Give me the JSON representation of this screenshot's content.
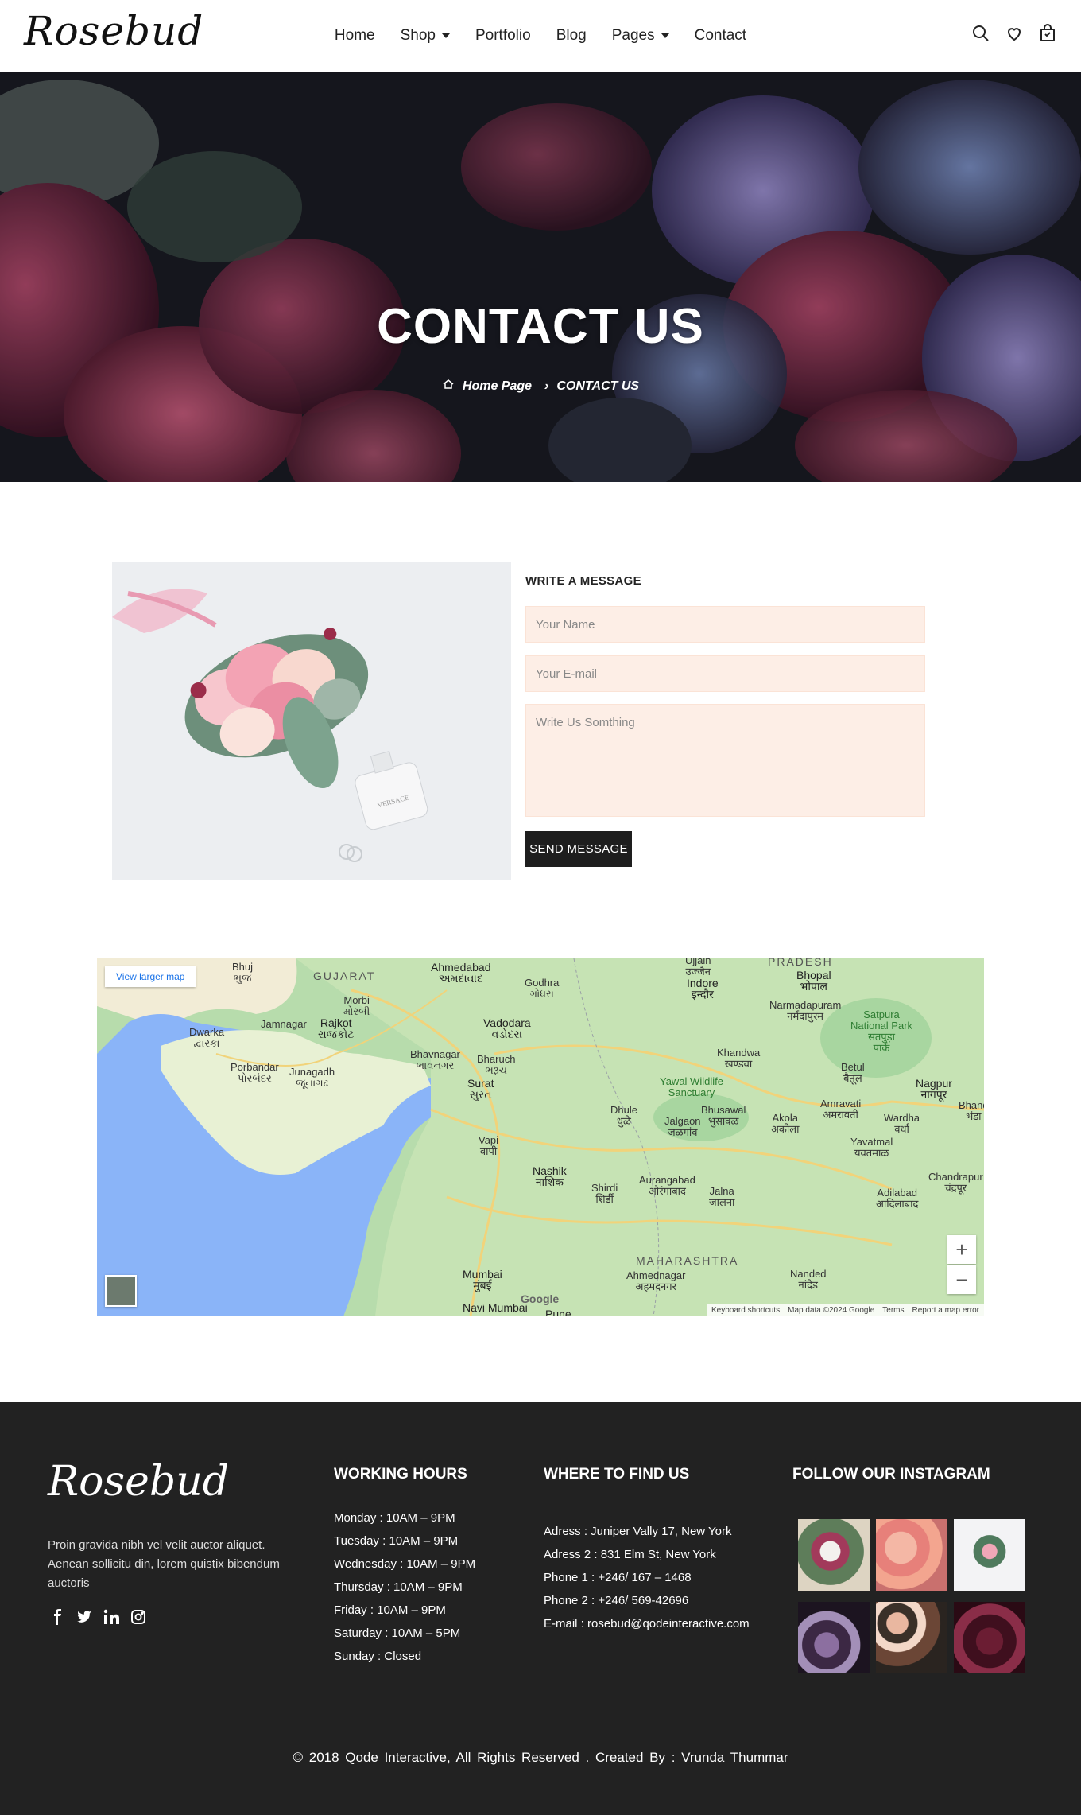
{
  "header": {
    "logo": "Rosebud",
    "nav": [
      {
        "label": "Home",
        "dropdown": false
      },
      {
        "label": "Shop",
        "dropdown": true
      },
      {
        "label": "Portfolio",
        "dropdown": false
      },
      {
        "label": "Blog",
        "dropdown": false
      },
      {
        "label": "Pages",
        "dropdown": true
      },
      {
        "label": "Contact",
        "dropdown": false
      }
    ],
    "icons": [
      "search-icon",
      "heart-icon",
      "cart-icon"
    ]
  },
  "hero": {
    "title": "CONTACT US",
    "breadcrumb": {
      "home": "Home Page",
      "current": "CONTACT US"
    }
  },
  "contact": {
    "form_title": "WRITE A MESSAGE",
    "name_placeholder": "Your Name",
    "email_placeholder": "Your E-mail",
    "message_placeholder": "Write Us Somthing",
    "send_label": "SEND MESSAGE"
  },
  "map": {
    "view_larger": "View larger map",
    "zoom_in": "+",
    "zoom_out": "−",
    "footer_items": [
      "Keyboard shortcuts",
      "Map data ©2024 Google",
      "Terms",
      "Report a map error"
    ],
    "labels": {
      "bhuj": "Bhuj\nભુજ",
      "gujarat": "GUJARAT",
      "ahmedabad": "Ahmedabad\nઅમદાવાદ",
      "ujjain": "Ujjain\nउज्जैन",
      "pradesh": "PRADESH",
      "bhopal": "Bhopal\nभोपाल",
      "godhra": "Godhra\nગોધરા",
      "indore": "Indore\nइन्दौर",
      "narmadapuram": "Narmadapuram\nनर्मदापुरम",
      "morbi": "Morbi\nમોરબી",
      "jamnagar": "Jamnagar",
      "rajkot": "Rajkot\nરાજકોટ",
      "vadodara": "Vadodara\nવડોદરા",
      "satpura": "Satpura\nNational Park\nसतपुड़ा\nपार्क",
      "dwarka": "Dwarka\nદ્વારકા",
      "khandwa": "Khandwa\nखण्डवा",
      "bhavnagar": "Bhavnagar\nભાવનગર",
      "bharuch": "Bharuch\nભરૂચ",
      "porbandar": "Porbandar\nપોરબંદર",
      "junagadh": "Junagadh\nજૂનાગઢ",
      "betul": "Betul\nबैतूल",
      "yawal": "Yawal Wildlife\nSanctuary",
      "surat": "Surat\nસુરત",
      "nagpur": "Nagpur\nनागपूर",
      "amravati": "Amravati\nअमरावती",
      "dhule": "Dhule\nधुळे",
      "bhusawal": "Bhusawal\nभुसावळ",
      "akola": "Akola\nअकोला",
      "wardha": "Wardha\nवर्धा",
      "jalgaon": "Jalgaon\nजळगांव",
      "bhanda": "Bhand\nभंडा",
      "vapi": "Vapi\nवापी",
      "yavatmal": "Yavatmal\nयवतमाळ",
      "nashik": "Nashik\nनाशिक",
      "aurangabad": "Aurangabad\nऔरंगाबाद",
      "shirdi": "Shirdi\nशिर्डी",
      "jalna": "Jalna\nजालना",
      "adilabad": "Adilabad\nआदिलाबाद",
      "chandrapur": "Chandrapur\nचंद्रपूर",
      "maharashtra": "MAHARASHTRA",
      "mumbai": "Mumbai\nमुंबई",
      "ahmednagar": "Ahmednagar\nअहमदनगर",
      "nanded": "Nanded\nनांदेड",
      "navimumbai": "Navi Mumbai",
      "pune": "Pune",
      "google": "Google"
    }
  },
  "footer": {
    "logo": "Rosebud",
    "description": "Proin gravida nibh vel velit auctor aliquet. Aenean sollicitu din, lorem quistix bibendum auctoris",
    "social": [
      "facebook-icon",
      "twitter-icon",
      "linkedin-icon",
      "instagram-icon"
    ],
    "hours_title": "WORKING HOURS",
    "hours": [
      "Monday : 10AM – 9PM",
      "Tuesday : 10AM – 9PM",
      "Wednesday : 10AM – 9PM",
      "Thursday : 10AM – 9PM",
      "Friday : 10AM – 9PM",
      "Saturday : 10AM – 5PM",
      "Sunday : Closed"
    ],
    "find_title": "WHERE TO FIND US",
    "find": [
      "Adress : Juniper Vally 17, New York",
      "Adress 2 : 831 Elm St, New York",
      "Phone 1 : +246/ 167 – 1468",
      "Phone 2 : +246/ 569-42696",
      "E-mail : rosebud@qodeinteractive.com"
    ],
    "insta_title": "FOLLOW OUR INSTAGRAM",
    "copyright": "© 2018 Qode Interactive, All Rights Reserved . Created By : Vrunda Thummar"
  }
}
